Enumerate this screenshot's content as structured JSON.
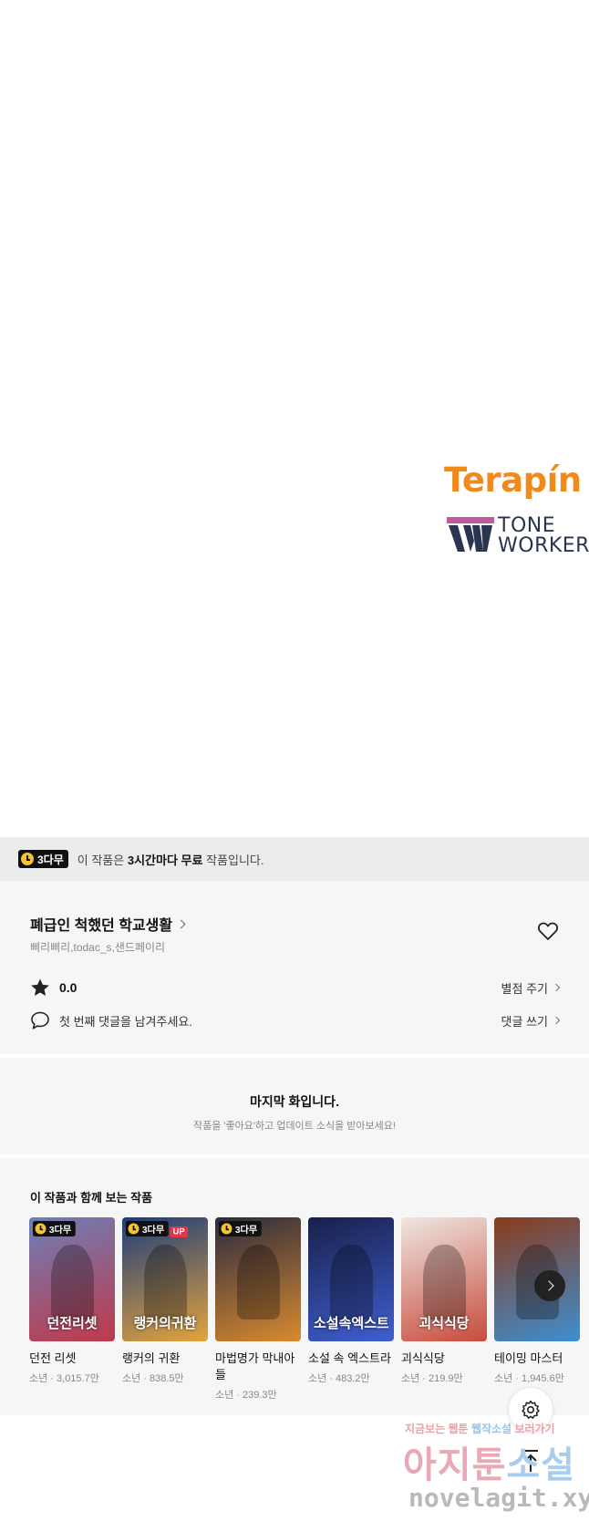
{
  "artwork": {
    "terapin_logo": "Terapín",
    "toneworker_line1": "TONE",
    "toneworker_line2": "WORKER"
  },
  "free_bar": {
    "badge_label": "3다무",
    "text_prefix": "이 작품은 ",
    "text_bold": "3시간마다 무료",
    "text_suffix": " 작품입니다."
  },
  "work": {
    "title": "폐급인 척했던 학교생활",
    "authors": "삐리삐리,todac_s,샌드페이리",
    "rating": "0.0",
    "rate_link": "별점 주기",
    "comment_prompt": "첫 번째 댓글을 남겨주세요.",
    "comment_link": "댓글 쓰기"
  },
  "last_episode": {
    "title": "마지막 화입니다.",
    "subtitle": "작품을 '좋아요'하고 업데이트 소식을 받아보세요!"
  },
  "recommendations": {
    "heading": "이 작품과 함께 보는 작품",
    "items": [
      {
        "title": "던전 리셋",
        "meta": "소년 · 3,015.7만",
        "badge": "3다무",
        "up": "",
        "cover_text": "던전리셋",
        "colors": [
          "#6d7fb8",
          "#c0394a"
        ]
      },
      {
        "title": "랭커의 귀환",
        "meta": "소년 · 838.5만",
        "badge": "3다무",
        "up": "UP",
        "cover_text": "랭커의귀환",
        "colors": [
          "#1d3c7a",
          "#e3a43c"
        ]
      },
      {
        "title": "마법명가 막내아들",
        "meta": "소년 · 239.3만",
        "badge": "3다무",
        "up": "",
        "cover_text": "",
        "colors": [
          "#2b2a3d",
          "#d98a2f"
        ]
      },
      {
        "title": "소설 속 엑스트라",
        "meta": "소년 · 483.2만",
        "badge": "",
        "up": "",
        "cover_text": "소설속엑스트라",
        "colors": [
          "#18204a",
          "#3f5fd1"
        ]
      },
      {
        "title": "괴식식당",
        "meta": "소년 · 219.9만",
        "badge": "",
        "up": "",
        "cover_text": "괴식식당",
        "colors": [
          "#efe7e1",
          "#c84b3c"
        ]
      },
      {
        "title": "테이밍 마스터",
        "meta": "소년 · 1,945.6만",
        "badge": "",
        "up": "",
        "cover_text": "",
        "colors": [
          "#8a3b1c",
          "#3d8fd1"
        ]
      }
    ]
  },
  "watermark": {
    "line1_a": "지금보는 웹툰 ",
    "line1_b": "웹작소설",
    "line1_c": " 보러가기",
    "line2_a": "아지툰",
    "line2_b": "소설",
    "line3": "novelagit.xyz"
  },
  "colors": {
    "terapin_orange": "#f08a1c",
    "badge_yellow": "#f7c32e",
    "up_red": "#e8324a"
  },
  "icons": {
    "heart": "heart-outline-icon",
    "star": "star-filled-icon",
    "comment": "speech-bubble-icon",
    "next": "chevron-right-icon",
    "settings": "gear-icon",
    "top": "arrow-up-to-top-icon"
  }
}
